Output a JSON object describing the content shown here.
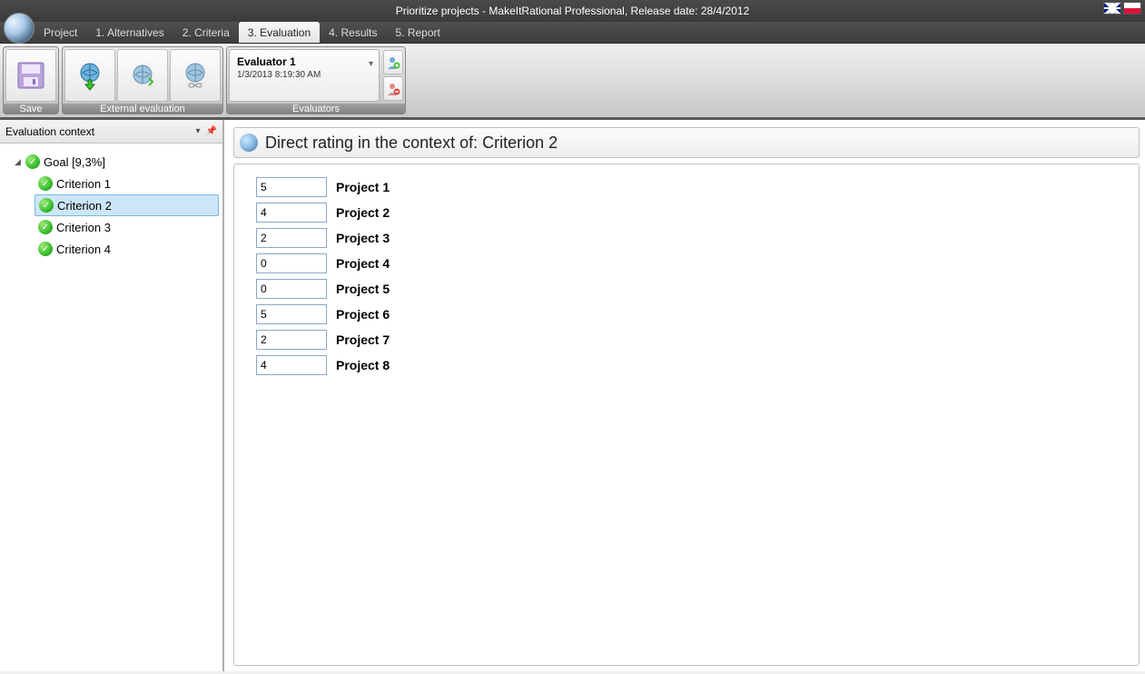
{
  "titlebar": {
    "text": "Prioritize projects - MakeItRational Professional, Release date: 28/4/2012"
  },
  "menu": {
    "items": [
      "Project",
      "1. Alternatives",
      "2. Criteria",
      "3. Evaluation",
      "4. Results",
      "5. Report"
    ],
    "active_index": 3
  },
  "ribbon": {
    "save_group_label": "Save",
    "external_group_label": "External evaluation",
    "evaluators_group_label": "Evaluators",
    "evaluator": {
      "name": "Evaluator 1",
      "timestamp": "1/3/2013 8:19:30 AM"
    }
  },
  "sidebar": {
    "header": "Evaluation context",
    "goal_label": "Goal [9,3%]",
    "criteria": [
      "Criterion 1",
      "Criterion 2",
      "Criterion 3",
      "Criterion 4"
    ],
    "selected_index": 1
  },
  "panel": {
    "title_prefix": "Direct rating in the context of: ",
    "title_context": "Criterion 2",
    "projects": [
      {
        "value": "5",
        "label": "Project 1"
      },
      {
        "value": "4",
        "label": "Project 2"
      },
      {
        "value": "2",
        "label": "Project 3"
      },
      {
        "value": "0",
        "label": "Project 4"
      },
      {
        "value": "0",
        "label": "Project 5"
      },
      {
        "value": "5",
        "label": "Project 6"
      },
      {
        "value": "2",
        "label": "Project 7"
      },
      {
        "value": "4",
        "label": "Project 8"
      }
    ]
  }
}
